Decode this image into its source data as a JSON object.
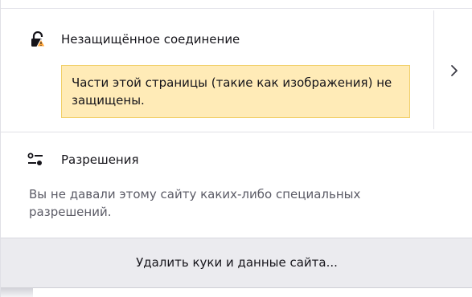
{
  "security": {
    "title": "Незащищённое соединение",
    "warning": "Части этой страницы (такие как изображения) не защищены.",
    "lock_icon": "lock-warning-icon",
    "expand_icon": "chevron-right-icon"
  },
  "permissions": {
    "title": "Разрешения",
    "description": "Вы не давали этому сайту каких-либо специальных разрешений.",
    "icon": "permissions-icon"
  },
  "actions": {
    "clear_label": "Удалить куки и данные сайта..."
  },
  "colors": {
    "warning_bg": "#ffebb7",
    "warning_border": "#f1cf68",
    "button_bg": "#ebebef"
  }
}
